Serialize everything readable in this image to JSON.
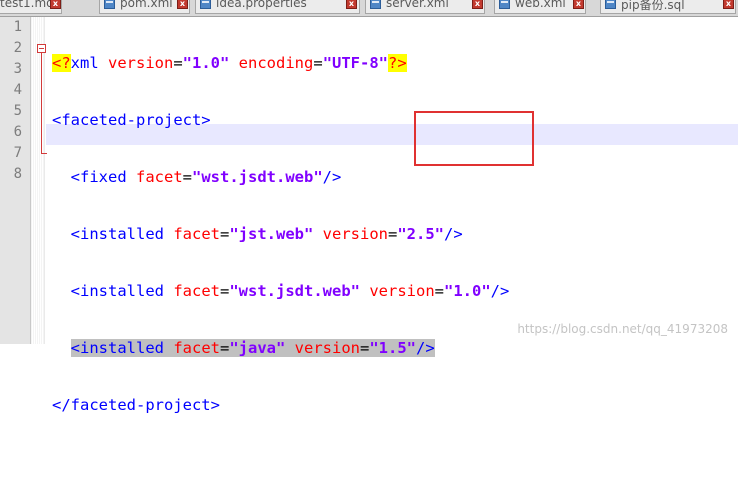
{
  "tabs": [
    {
      "label": "test1.md"
    },
    {
      "label": "pom.xml"
    },
    {
      "label": "idea.properties"
    },
    {
      "label": "server.xml"
    },
    {
      "label": "web.xml"
    },
    {
      "label": "pip备份.sql"
    }
  ],
  "line_numbers": [
    "1",
    "2",
    "3",
    "4",
    "5",
    "6",
    "7",
    "8"
  ],
  "code": {
    "line1": {
      "open": "<?",
      "decl": "xml",
      "attr1": " version",
      "val1": "\"1.0\"",
      "attr2": " encoding",
      "val2": "\"UTF-8\"",
      "close": "?>"
    },
    "line2": {
      "tag": "<faceted-project>"
    },
    "line3": {
      "tag_open": "<fixed",
      "attr": " facet",
      "val": "\"wst.jsdt.web\"",
      "tag_close": "/>"
    },
    "line4": {
      "tag_open": "<installed",
      "attr1": " facet",
      "val1": "\"jst.web\"",
      "attr2": " version",
      "val2": "\"2.5\"",
      "tag_close": "/>"
    },
    "line5": {
      "tag_open": "<installed",
      "attr1": " facet",
      "val1": "\"wst.jsdt.web\"",
      "attr2": " version",
      "val2": "\"1.0\"",
      "tag_close": "/>"
    },
    "line6": {
      "tag_open": "<installed",
      "attr1": " facet",
      "val1": "\"java\"",
      "attr2": " version",
      "val2": "\"1.5\"",
      "tag_close": "/>"
    },
    "line7": {
      "tag": "</faceted-project>"
    }
  },
  "watermark": "https://blog.csdn.net/qq_41973208",
  "colors": {
    "tag": "#0000ff",
    "attribute": "#ff0000",
    "value": "#8000ff",
    "annotation_box": "#e03131",
    "current_line": "#e8e8ff"
  }
}
